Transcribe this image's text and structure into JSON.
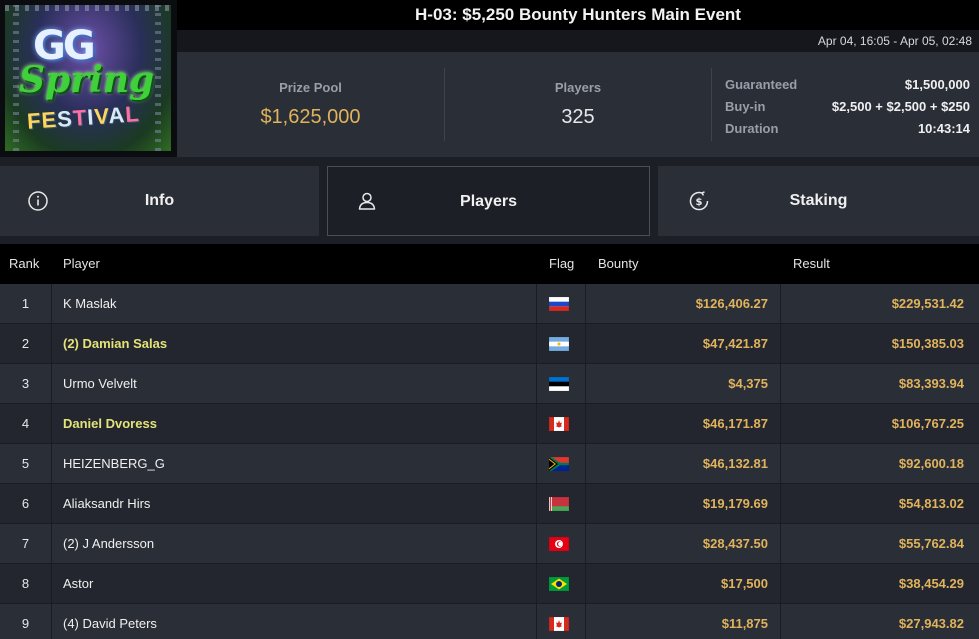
{
  "title": "H-03: $5,250 Bounty Hunters Main Event",
  "dates": "Apr 04, 16:05 - Apr 05, 02:48",
  "logo": {
    "line1": "GG",
    "line2": "Spring",
    "line3": "FESTIVAL"
  },
  "stats": {
    "prize_pool_label": "Prize Pool",
    "prize_pool": "$1,625,000",
    "players_label": "Players",
    "players": "325",
    "guaranteed_label": "Guaranteed",
    "guaranteed": "$1,500,000",
    "buyin_label": "Buy-in",
    "buyin": "$2,500 + $2,500 + $250",
    "duration_label": "Duration",
    "duration": "10:43:14"
  },
  "tabs": {
    "info": {
      "label": "Info",
      "icon": "info-icon"
    },
    "players": {
      "label": "Players",
      "icon": "user-icon"
    },
    "staking": {
      "label": "Staking",
      "icon": "dollar-coin-icon"
    }
  },
  "table": {
    "headers": {
      "rank": "Rank",
      "player": "Player",
      "flag": "Flag",
      "bounty": "Bounty",
      "result": "Result"
    },
    "rows": [
      {
        "rank": "1",
        "player": "K Maslak",
        "flag": "russia",
        "bounty": "$126,406.27",
        "result": "$229,531.42",
        "highlight": false
      },
      {
        "rank": "2",
        "player": "(2) Damian Salas",
        "flag": "argentina",
        "bounty": "$47,421.87",
        "result": "$150,385.03",
        "highlight": true
      },
      {
        "rank": "3",
        "player": "Urmo Velvelt",
        "flag": "estonia",
        "bounty": "$4,375",
        "result": "$83,393.94",
        "highlight": false
      },
      {
        "rank": "4",
        "player": "Daniel Dvoress",
        "flag": "canada",
        "bounty": "$46,171.87",
        "result": "$106,767.25",
        "highlight": true
      },
      {
        "rank": "5",
        "player": "HEIZENBERG_G",
        "flag": "south-africa",
        "bounty": "$46,132.81",
        "result": "$92,600.18",
        "highlight": false
      },
      {
        "rank": "6",
        "player": "Aliaksandr Hirs",
        "flag": "belarus",
        "bounty": "$19,179.69",
        "result": "$54,813.02",
        "highlight": false
      },
      {
        "rank": "7",
        "player": "(2) J Andersson",
        "flag": "tunisia",
        "bounty": "$28,437.50",
        "result": "$55,762.84",
        "highlight": false
      },
      {
        "rank": "8",
        "player": "Astor",
        "flag": "brazil",
        "bounty": "$17,500",
        "result": "$38,454.29",
        "highlight": false
      },
      {
        "rank": "9",
        "player": "(4) David Peters",
        "flag": "canada",
        "bounty": "$11,875",
        "result": "$27,943.82",
        "highlight": false
      }
    ]
  },
  "colors": {
    "gold": "#e0b35c",
    "highlight_name": "#e3e378",
    "panel": "#2a2e37",
    "background": "#1c1f26"
  }
}
